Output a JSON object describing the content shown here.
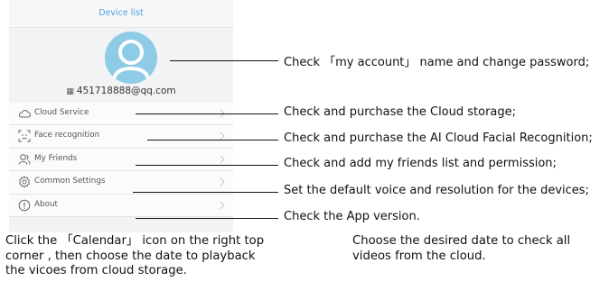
{
  "phone": {
    "title": "Device list",
    "account": "451718888@qq.com",
    "menu": [
      {
        "label": "Cloud Service",
        "icon": "cloud-icon"
      },
      {
        "label": "Face recognition",
        "icon": "face-scan-icon"
      },
      {
        "label": "My Friends",
        "icon": "friends-icon"
      },
      {
        "label": "Common Settings",
        "icon": "gear-icon"
      },
      {
        "label": "About",
        "icon": "info-icon"
      }
    ]
  },
  "annotations": {
    "account": "Check 「my account」 name and change password;",
    "cloud": "Check and purchase the Cloud storage;",
    "face": "Check and purchase the AI Cloud Facial Recognition;",
    "friends": "Check and add my friends list and permission;",
    "settings": "Set the default voice and resolution for the devices;",
    "about": "Check the App version."
  },
  "footer": {
    "left": "Click the 「Calendar」 icon on the right top corner , then choose the date to playback the vicoes from cloud storage.",
    "right": "Choose the desired date to check all videos from the cloud."
  },
  "colors": {
    "title": "#4aa3d8",
    "avatar": "#8ecbe6",
    "line": "#111111"
  }
}
